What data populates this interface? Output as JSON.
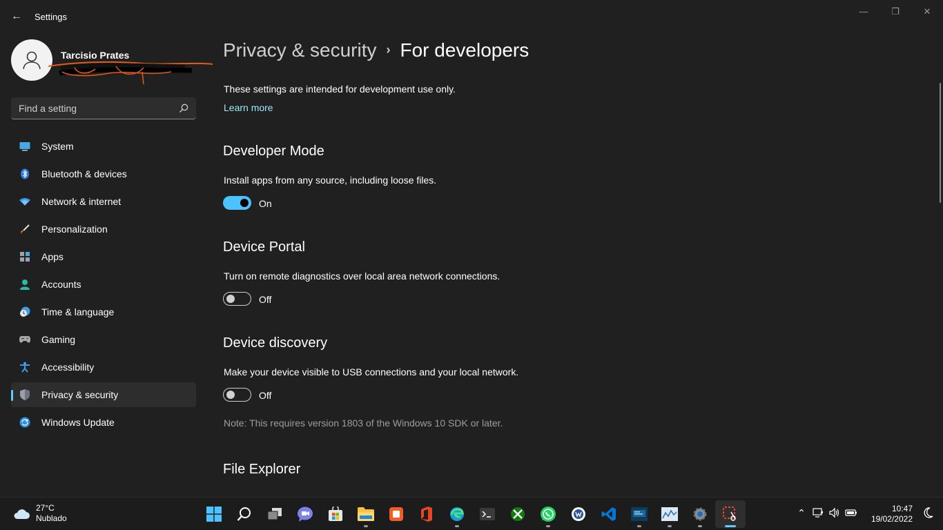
{
  "window": {
    "title": "Settings",
    "back_icon": "←",
    "minimize_icon": "—",
    "maximize_icon": "❐",
    "close_icon": "✕"
  },
  "profile": {
    "name": "Tarcisio Prates"
  },
  "search": {
    "placeholder": "Find a setting"
  },
  "sidebar": {
    "items": [
      {
        "label": "System",
        "icon": "system-icon"
      },
      {
        "label": "Bluetooth & devices",
        "icon": "bluetooth-icon"
      },
      {
        "label": "Network & internet",
        "icon": "wifi-icon"
      },
      {
        "label": "Personalization",
        "icon": "brush-icon"
      },
      {
        "label": "Apps",
        "icon": "apps-icon"
      },
      {
        "label": "Accounts",
        "icon": "person-icon"
      },
      {
        "label": "Time & language",
        "icon": "clock-globe-icon"
      },
      {
        "label": "Gaming",
        "icon": "gamepad-icon"
      },
      {
        "label": "Accessibility",
        "icon": "accessibility-icon"
      },
      {
        "label": "Privacy & security",
        "icon": "shield-icon",
        "active": true
      },
      {
        "label": "Windows Update",
        "icon": "update-icon"
      }
    ]
  },
  "breadcrumb": {
    "parent": "Privacy & security",
    "separator": "›",
    "current": "For developers"
  },
  "intro": {
    "text": "These settings are intended for development use only.",
    "learn_more": "Learn more"
  },
  "sections": {
    "developer_mode": {
      "title": "Developer Mode",
      "description": "Install apps from any source, including loose files.",
      "state": "On"
    },
    "device_portal": {
      "title": "Device Portal",
      "description": "Turn on remote diagnostics over local area network connections.",
      "state": "Off"
    },
    "device_discovery": {
      "title": "Device discovery",
      "description": "Make your device visible to USB connections and your local network.",
      "state": "Off",
      "note": "Note: This requires version 1803 of the Windows 10 SDK or later."
    },
    "file_explorer": {
      "title": "File Explorer"
    }
  },
  "taskbar": {
    "weather": {
      "temp": "27°C",
      "condition": "Nublado"
    },
    "apps": [
      "windows-start",
      "search",
      "task-view",
      "teams-chat",
      "microsoft-store",
      "file-explorer",
      "sticky-app",
      "office",
      "edge",
      "terminal",
      "xbox",
      "whatsapp",
      "word-app",
      "vscode",
      "photos-app",
      "resource-monitor",
      "settings",
      "snipping-tool"
    ],
    "tray": {
      "chevron": "⌃",
      "speaker": "🔊",
      "battery": "🔋"
    },
    "clock": {
      "time": "10:47",
      "date": "19/02/2022"
    }
  },
  "colors": {
    "accent": "#4cc2ff",
    "link": "#99ebff",
    "background": "#202020",
    "taskbar": "#1c1c1c"
  }
}
